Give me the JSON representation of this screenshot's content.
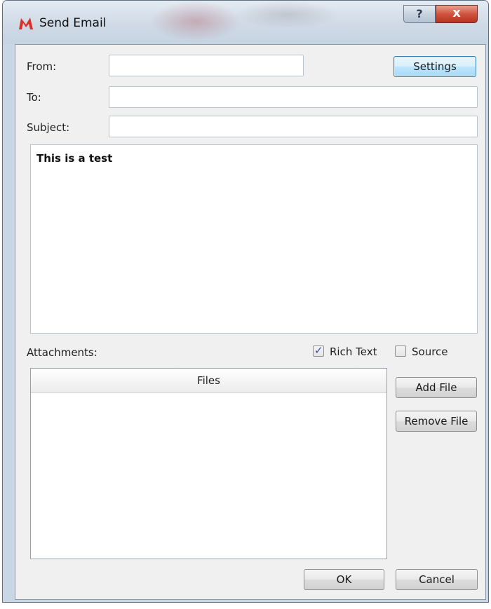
{
  "window": {
    "title": "Send Email",
    "help_label": "?",
    "close_label": "x"
  },
  "form": {
    "from_label": "From:",
    "from_value": "",
    "to_label": "To:",
    "to_value": "",
    "subject_label": "Subject:",
    "subject_value": "",
    "settings_button": "Settings"
  },
  "body": {
    "text": "This is a test"
  },
  "attachments": {
    "label": "Attachments:",
    "rich_text_label": "Rich Text",
    "rich_text_checked": true,
    "source_label": "Source",
    "source_checked": false,
    "files_header": "Files",
    "files": [],
    "add_file_button": "Add File",
    "remove_file_button": "Remove File"
  },
  "footer": {
    "ok_button": "OK",
    "cancel_button": "Cancel"
  },
  "colors": {
    "app_icon": "#d8322a",
    "close_button": "#c84030",
    "checkmark": "#2b4fa6"
  },
  "icons": {
    "app": "app-logo-icon",
    "help": "help-icon",
    "close": "close-icon",
    "checkmark": "checkmark-icon"
  }
}
